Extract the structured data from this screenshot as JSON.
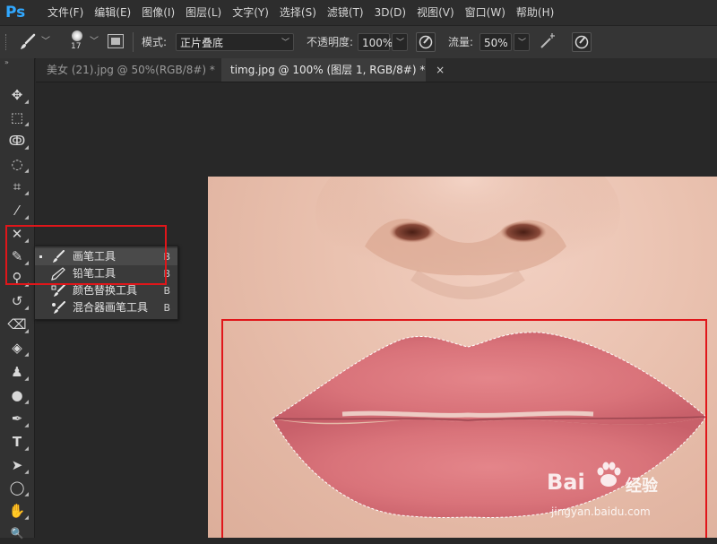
{
  "app": {
    "logo_text": "Ps",
    "accent": "#31a8ff"
  },
  "menu": [
    {
      "label": "文件(F)"
    },
    {
      "label": "编辑(E)"
    },
    {
      "label": "图像(I)"
    },
    {
      "label": "图层(L)"
    },
    {
      "label": "文字(Y)"
    },
    {
      "label": "选择(S)"
    },
    {
      "label": "滤镜(T)"
    },
    {
      "label": "3D(D)"
    },
    {
      "label": "视图(V)"
    },
    {
      "label": "窗口(W)"
    },
    {
      "label": "帮助(H)"
    }
  ],
  "options": {
    "brush_size": "17",
    "mode_label": "模式:",
    "mode_value": "正片叠底",
    "opacity_label": "不透明度:",
    "opacity_value": "100%",
    "flow_label": "流量:",
    "flow_value": "50%"
  },
  "tabs": [
    {
      "label": "美女 (21).jpg @ 50%(RGB/8#) *",
      "close": "×",
      "active": false
    },
    {
      "label": "timg.jpg @ 100% (图层 1, RGB/8#) *",
      "close": "×",
      "active": true
    }
  ],
  "toolbar": {
    "tools": [
      {
        "name": "move-tool-icon",
        "glyph": "✥"
      },
      {
        "name": "marquee-tool-icon",
        "glyph": "⬚"
      },
      {
        "name": "lasso-tool-icon",
        "glyph": "ↂ"
      },
      {
        "name": "quick-select-tool-icon",
        "glyph": "◌"
      },
      {
        "name": "crop-tool-icon",
        "glyph": "⌗"
      },
      {
        "name": "eyedropper-tool-icon",
        "glyph": "⁄"
      },
      {
        "name": "healing-tool-icon",
        "glyph": "✕"
      },
      {
        "name": "brush-tool-icon",
        "glyph": "✎"
      },
      {
        "name": "clone-stamp-tool-icon",
        "glyph": "⚲"
      },
      {
        "name": "history-brush-tool-icon",
        "glyph": "↺"
      },
      {
        "name": "eraser-tool-icon",
        "glyph": "⌫"
      },
      {
        "name": "paint-bucket-tool-icon",
        "glyph": "◈"
      },
      {
        "name": "dodge-tool-icon",
        "glyph": "♟"
      },
      {
        "name": "burn-tool-icon",
        "glyph": "●"
      },
      {
        "name": "pen-tool-icon",
        "glyph": "✒"
      },
      {
        "name": "type-tool-icon",
        "glyph": "T"
      },
      {
        "name": "path-select-tool-icon",
        "glyph": "➤"
      },
      {
        "name": "ellipse-tool-icon",
        "glyph": "◯"
      },
      {
        "name": "hand-tool-icon",
        "glyph": "✋"
      },
      {
        "name": "zoom-tool-icon",
        "glyph": "🔍"
      }
    ]
  },
  "flyout": {
    "items": [
      {
        "label": "画笔工具",
        "key": "B",
        "selected": true
      },
      {
        "label": "铅笔工具",
        "key": "B",
        "selected": false
      },
      {
        "label": "颜色替换工具",
        "key": "B",
        "selected": false
      },
      {
        "label": "混合器画笔工具",
        "key": "B",
        "selected": false
      }
    ]
  },
  "watermark": {
    "brand": "Bai",
    "brand_suffix": "经验",
    "url": "jingyan.baidu.com"
  },
  "colors": {
    "highlight": "#e0161a",
    "selection": "#ffffff"
  }
}
